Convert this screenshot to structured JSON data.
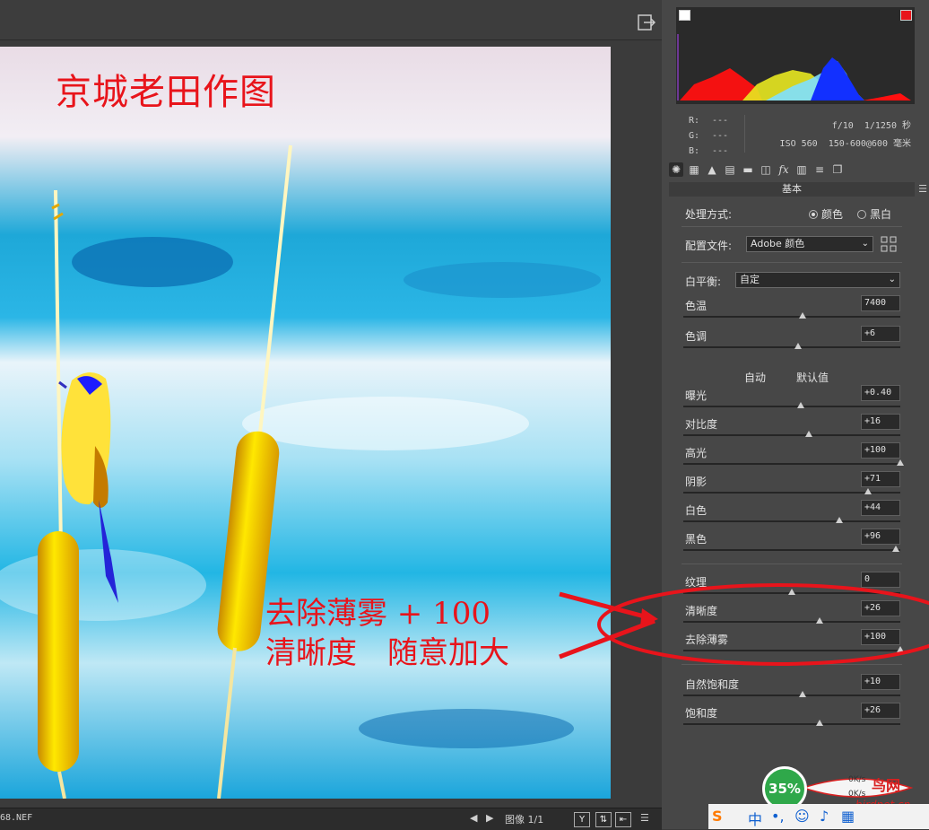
{
  "window": {
    "export_icon": "export-icon"
  },
  "photo": {
    "watermark_title": "京城老田作图",
    "annotation_line1": "去除薄雾 + 100",
    "annotation_line2": "清晰度　随意加大"
  },
  "statusbar": {
    "filename": "68.NEF",
    "image_label": "图像 1/1",
    "buttons": [
      "Y",
      "⇅",
      "⇤"
    ]
  },
  "histogram": {
    "r_label": "R:",
    "r_value": "---",
    "g_label": "G:",
    "g_value": "---",
    "b_label": "B:",
    "b_value": "---",
    "aperture": "f/10",
    "shutter": "1/1250 秒",
    "iso": "ISO 560",
    "lens": "150-600@600 毫米",
    "colors": {
      "red": "#ff1010",
      "yellow": "#e8e820",
      "blue": "#1230ff",
      "cyan": "#7ee0ff"
    }
  },
  "panel": {
    "section_title": "基本",
    "treatment_label": "处理方式:",
    "treatment_color": "颜色",
    "treatment_bw": "黑白",
    "profile_label": "配置文件:",
    "profile_value": "Adobe 颜色",
    "wb_label": "白平衡:",
    "wb_value": "自定",
    "auto_label": "自动",
    "default_label": "默认值",
    "sliders": [
      {
        "label": "色温",
        "value": "7400",
        "pos": 0.55
      },
      {
        "label": "色调",
        "value": "+6",
        "pos": 0.53
      },
      {
        "label": "曝光",
        "value": "+0.40",
        "pos": 0.54
      },
      {
        "label": "对比度",
        "value": "+16",
        "pos": 0.58
      },
      {
        "label": "高光",
        "value": "+100",
        "pos": 1.0
      },
      {
        "label": "阴影",
        "value": "+71",
        "pos": 0.85
      },
      {
        "label": "白色",
        "value": "+44",
        "pos": 0.72
      },
      {
        "label": "黑色",
        "value": "+96",
        "pos": 0.98
      },
      {
        "label": "纹理",
        "value": "0",
        "pos": 0.5
      },
      {
        "label": "清晰度",
        "value": "+26",
        "pos": 0.63
      },
      {
        "label": "去除薄雾",
        "value": "+100",
        "pos": 1.0
      },
      {
        "label": "自然饱和度",
        "value": "+10",
        "pos": 0.55
      },
      {
        "label": "饱和度",
        "value": "+26",
        "pos": 0.63
      }
    ]
  },
  "meter": {
    "percent": "35%",
    "up": "0K/s",
    "down": "0K/s",
    "site": "birdnet.cn",
    "site_logo_text": "鸟网"
  },
  "taskbar": {
    "input_method": "中"
  }
}
